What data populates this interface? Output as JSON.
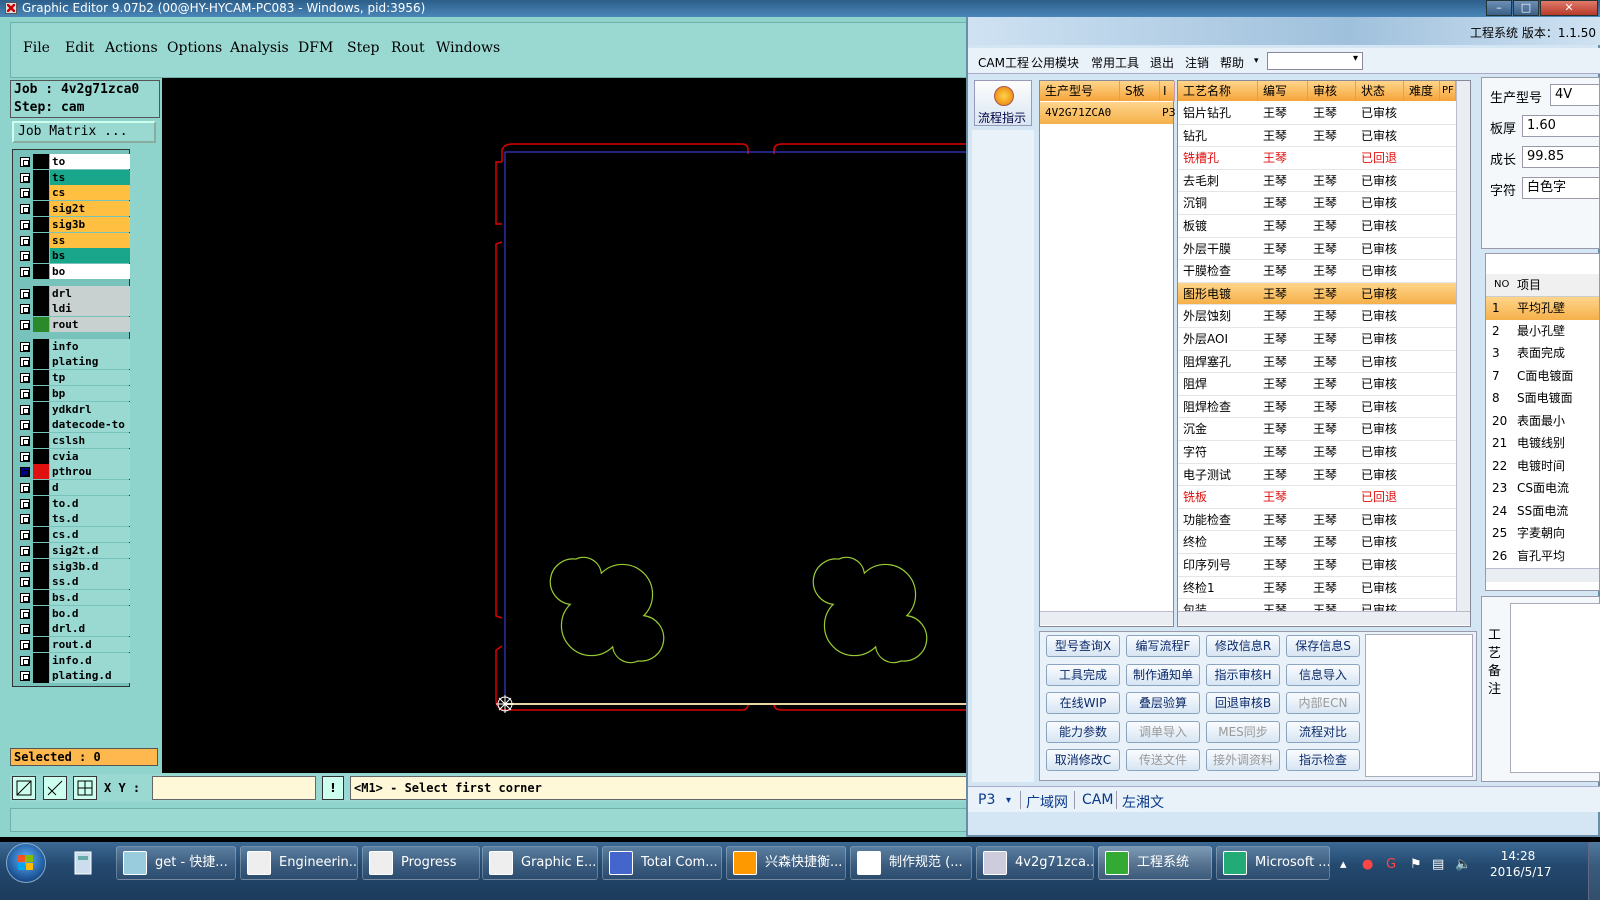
{
  "ge": {
    "title": "Graphic Editor 9.07b2 (00@HY-HYCAM-PC083 - Windows, pid:3956)",
    "menu": [
      "File",
      "Edit",
      "Actions",
      "Options",
      "Analysis",
      "DFM",
      "Step",
      "Rout",
      "Windows"
    ],
    "job_line": "Job : 4v2g71zca0",
    "step_line": "Step: cam",
    "job_matrix": "Job Matrix ...",
    "layers": [
      {
        "name": "to",
        "color": "#ffffff"
      },
      {
        "name": "ts",
        "color": "#1aa68a"
      },
      {
        "name": "cs",
        "color": "#ffbf40"
      },
      {
        "name": "sig2t",
        "color": "#ffbf40"
      },
      {
        "name": "sig3b",
        "color": "#ffbf40"
      },
      {
        "name": "ss",
        "color": "#ffbf40"
      },
      {
        "name": "bs",
        "color": "#1aa68a"
      },
      {
        "name": "bo",
        "color": "#ffffff"
      },
      {
        "name": "drl",
        "color": "#c8d0d0"
      },
      {
        "name": "ldi",
        "color": "#c8d0d0"
      },
      {
        "name": "rout",
        "color": "#c8d0d0"
      },
      {
        "name": "info",
        "color": "#9ad8d2"
      },
      {
        "name": "plating",
        "color": "#9ad8d2"
      },
      {
        "name": "tp",
        "color": "#9ad8d2"
      },
      {
        "name": "bp",
        "color": "#9ad8d2"
      },
      {
        "name": "ydkdrl",
        "color": "#9ad8d2"
      },
      {
        "name": "datecode-to",
        "color": "#9ad8d2"
      },
      {
        "name": "cslsh",
        "color": "#9ad8d2"
      },
      {
        "name": "cvia",
        "color": "#9ad8d2"
      },
      {
        "name": "pthrou",
        "color": "#9ad8d2"
      },
      {
        "name": "d",
        "color": "#9ad8d2"
      },
      {
        "name": "to.d",
        "color": "#9ad8d2"
      },
      {
        "name": "ts.d",
        "color": "#9ad8d2"
      },
      {
        "name": "cs.d",
        "color": "#9ad8d2"
      },
      {
        "name": "sig2t.d",
        "color": "#9ad8d2"
      },
      {
        "name": "sig3b.d",
        "color": "#9ad8d2"
      },
      {
        "name": "ss.d",
        "color": "#9ad8d2"
      },
      {
        "name": "bs.d",
        "color": "#9ad8d2"
      },
      {
        "name": "bo.d",
        "color": "#9ad8d2"
      },
      {
        "name": "drl.d",
        "color": "#9ad8d2"
      },
      {
        "name": "rout.d",
        "color": "#9ad8d2"
      },
      {
        "name": "info.d",
        "color": "#9ad8d2"
      },
      {
        "name": "plating.d",
        "color": "#9ad8d2"
      }
    ],
    "selected": "Selected : 0",
    "xy_label": "X Y :",
    "prompt": "<M1> - Select first corner"
  },
  "cam": {
    "title": "工程系统  版本：1.1.50",
    "menu": [
      "CAM工程",
      "公用模块",
      "常用工具",
      "退出",
      "注销",
      "帮助"
    ],
    "flow_label": "流程指示",
    "grid1": {
      "headers": [
        "生产型号",
        "S板",
        "I"
      ],
      "rows": [
        [
          "4V2G71ZCA0",
          "",
          "P3"
        ]
      ]
    },
    "grid2": {
      "headers": [
        "工艺名称",
        "编写",
        "审核",
        "状态",
        "难度",
        "PF"
      ],
      "rows": [
        [
          "铝片钻孔",
          "王琴",
          "王琴",
          "已审核"
        ],
        [
          "钻孔",
          "王琴",
          "王琴",
          "已审核"
        ],
        [
          "铣槽孔",
          "王琴",
          "",
          "已回退"
        ],
        [
          "去毛刺",
          "王琴",
          "王琴",
          "已审核"
        ],
        [
          "沉铜",
          "王琴",
          "王琴",
          "已审核"
        ],
        [
          "板镀",
          "王琴",
          "王琴",
          "已审核"
        ],
        [
          "外层干膜",
          "王琴",
          "王琴",
          "已审核"
        ],
        [
          "干膜检查",
          "王琴",
          "王琴",
          "已审核"
        ],
        [
          "图形电镀",
          "王琴",
          "王琴",
          "已审核"
        ],
        [
          "外层蚀刻",
          "王琴",
          "王琴",
          "已审核"
        ],
        [
          "外层AOI",
          "王琴",
          "王琴",
          "已审核"
        ],
        [
          "阻焊塞孔",
          "王琴",
          "王琴",
          "已审核"
        ],
        [
          "阻焊",
          "王琴",
          "王琴",
          "已审核"
        ],
        [
          "阻焊检查",
          "王琴",
          "王琴",
          "已审核"
        ],
        [
          "沉金",
          "王琴",
          "王琴",
          "已审核"
        ],
        [
          "字符",
          "王琴",
          "王琴",
          "已审核"
        ],
        [
          "电子测试",
          "王琴",
          "王琴",
          "已审核"
        ],
        [
          "铣板",
          "王琴",
          "",
          "已回退"
        ],
        [
          "功能检查",
          "王琴",
          "王琴",
          "已审核"
        ],
        [
          "终检",
          "王琴",
          "王琴",
          "已审核"
        ],
        [
          "印序列号",
          "王琴",
          "王琴",
          "已审核"
        ],
        [
          "终检1",
          "王琴",
          "王琴",
          "已审核"
        ],
        [
          "包装",
          "王琴",
          "王琴",
          "已审核"
        ]
      ]
    },
    "info": {
      "model_label": "生产型号",
      "model_value": "4V",
      "thickness_label": "板厚",
      "thickness_value": "1.60",
      "yield_label": "成长",
      "yield_value": "99.85",
      "char_label": "字符",
      "char_value": "白色字"
    },
    "grid3": {
      "headers": [
        "NO",
        "项目"
      ],
      "rows": [
        [
          "1",
          "平均孔壁"
        ],
        [
          "2",
          "最小孔壁"
        ],
        [
          "3",
          "表面完成"
        ],
        [
          "7",
          "C面电镀面"
        ],
        [
          "8",
          "S面电镀面"
        ],
        [
          "20",
          "表面最小"
        ],
        [
          "21",
          "电镀线别"
        ],
        [
          "22",
          "电镀时间"
        ],
        [
          "23",
          "CS面电流"
        ],
        [
          "24",
          "SS面电流"
        ],
        [
          "25",
          "字麦朝向"
        ],
        [
          "26",
          "盲孔平均"
        ]
      ]
    },
    "notes_label": "工艺备注",
    "buttons": [
      {
        "label": "型号查询X",
        "disabled": false
      },
      {
        "label": "编写流程F",
        "disabled": false
      },
      {
        "label": "修改信息R",
        "disabled": false
      },
      {
        "label": "保存信息S",
        "disabled": false
      },
      {
        "label": "工具完成",
        "disabled": false
      },
      {
        "label": "制作通知单",
        "disabled": false
      },
      {
        "label": "指示审核H",
        "disabled": false
      },
      {
        "label": "信息导入",
        "disabled": false
      },
      {
        "label": "在线WIP",
        "disabled": false
      },
      {
        "label": "叠层验算",
        "disabled": false
      },
      {
        "label": "回退审核B",
        "disabled": false
      },
      {
        "label": "内部ECN",
        "disabled": true
      },
      {
        "label": "能力参数",
        "disabled": false
      },
      {
        "label": "调单导入",
        "disabled": true
      },
      {
        "label": "MES同步",
        "disabled": true
      },
      {
        "label": "流程对比",
        "disabled": false
      },
      {
        "label": "取消修改C",
        "disabled": false
      },
      {
        "label": "传送文件",
        "disabled": true
      },
      {
        "label": "接外调资料",
        "disabled": true
      },
      {
        "label": "指示检查",
        "disabled": false
      }
    ],
    "bottom": {
      "p3": "P3",
      "net": "广域网",
      "cam": "CAM",
      "user": "左湘文"
    }
  },
  "taskbar": {
    "items": [
      "get - 快捷...",
      "Engineerin...",
      "Progress",
      "Graphic E...",
      "Total Com...",
      "兴森快捷衡...",
      "制作规范 (...",
      "4v2g71zca...",
      "工程系统",
      "Microsoft ..."
    ],
    "time": "14:28",
    "date": "2016/5/17"
  }
}
